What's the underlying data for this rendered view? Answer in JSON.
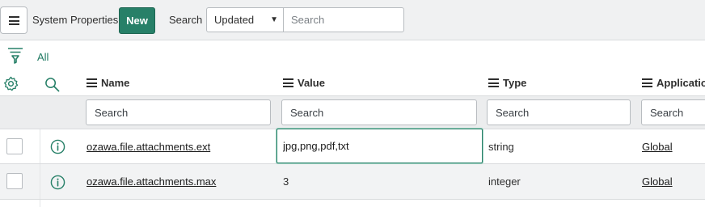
{
  "header": {
    "menu_icon": "hamburger-menu-icon",
    "title": "System Properties",
    "new_label": "New",
    "search_label": "Search",
    "search_field": {
      "selected": "Updated"
    },
    "search_placeholder": "Search"
  },
  "breadcrumb": {
    "filter_icon": "funnel-filter-icon",
    "all_label": "All"
  },
  "table": {
    "settings_icon": "gear-icon",
    "search_toggle_icon": "magnifier-icon",
    "columns": [
      {
        "label": "Name",
        "search_placeholder": "Search"
      },
      {
        "label": "Value",
        "search_placeholder": "Search"
      },
      {
        "label": "Type",
        "search_placeholder": "Search"
      },
      {
        "label": "Application",
        "search_placeholder": "Search"
      }
    ],
    "rows": [
      {
        "name": "ozawa.file.attachments.ext",
        "value": "jpg,png,pdf,txt",
        "type": "string",
        "application": "Global",
        "value_editing": true
      },
      {
        "name": "ozawa.file.attachments.max",
        "value": "3",
        "type": "integer",
        "application": "Global",
        "value_editing": false
      }
    ]
  },
  "colors": {
    "accent": "#278068",
    "header_bg": "#f0f1f2",
    "row_alt_bg": "#f2f3f4"
  }
}
